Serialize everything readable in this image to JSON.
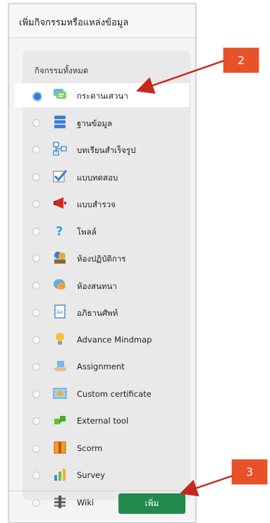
{
  "dialog": {
    "title": "เพิ่มกิจกรรมหรือแหล่งข้อมูล",
    "list_heading": "กิจกรรมทั้งหมด",
    "add_button": "เพิ่ม"
  },
  "items": [
    {
      "label": "กระดานเสวนา",
      "icon": "forum-icon",
      "selected": true
    },
    {
      "label": "ฐานข้อมูล",
      "icon": "database-icon",
      "selected": false
    },
    {
      "label": "บทเรียนสำเร็จรูป",
      "icon": "lesson-icon",
      "selected": false
    },
    {
      "label": "แบบทดสอบ",
      "icon": "quiz-icon",
      "selected": false
    },
    {
      "label": "แบบสำรวจ",
      "icon": "feedback-icon",
      "selected": false
    },
    {
      "label": "โพลล์",
      "icon": "choice-icon",
      "selected": false
    },
    {
      "label": "ห้องปฏิบัติการ",
      "icon": "workshop-icon",
      "selected": false
    },
    {
      "label": "ห้องสนทนา",
      "icon": "chat-icon",
      "selected": false
    },
    {
      "label": "อภิธานศัพท์",
      "icon": "glossary-icon",
      "selected": false
    },
    {
      "label": "Advance Mindmap",
      "icon": "lightbulb-icon",
      "selected": false
    },
    {
      "label": "Assignment",
      "icon": "assignment-icon",
      "selected": false
    },
    {
      "label": "Custom certificate",
      "icon": "certificate-icon",
      "selected": false
    },
    {
      "label": "External tool",
      "icon": "puzzle-icon",
      "selected": false
    },
    {
      "label": "Scorm",
      "icon": "scorm-icon",
      "selected": false
    },
    {
      "label": "Survey",
      "icon": "survey-icon",
      "selected": false
    },
    {
      "label": "Wiki",
      "icon": "wiki-icon",
      "selected": false
    }
  ],
  "callouts": {
    "list_callout": "2",
    "button_callout": "3"
  },
  "colors": {
    "accent": "#1f8a4c",
    "callout": "#e8512a",
    "arrow": "#c8281e",
    "selected_radio": "#3b7dd8"
  }
}
